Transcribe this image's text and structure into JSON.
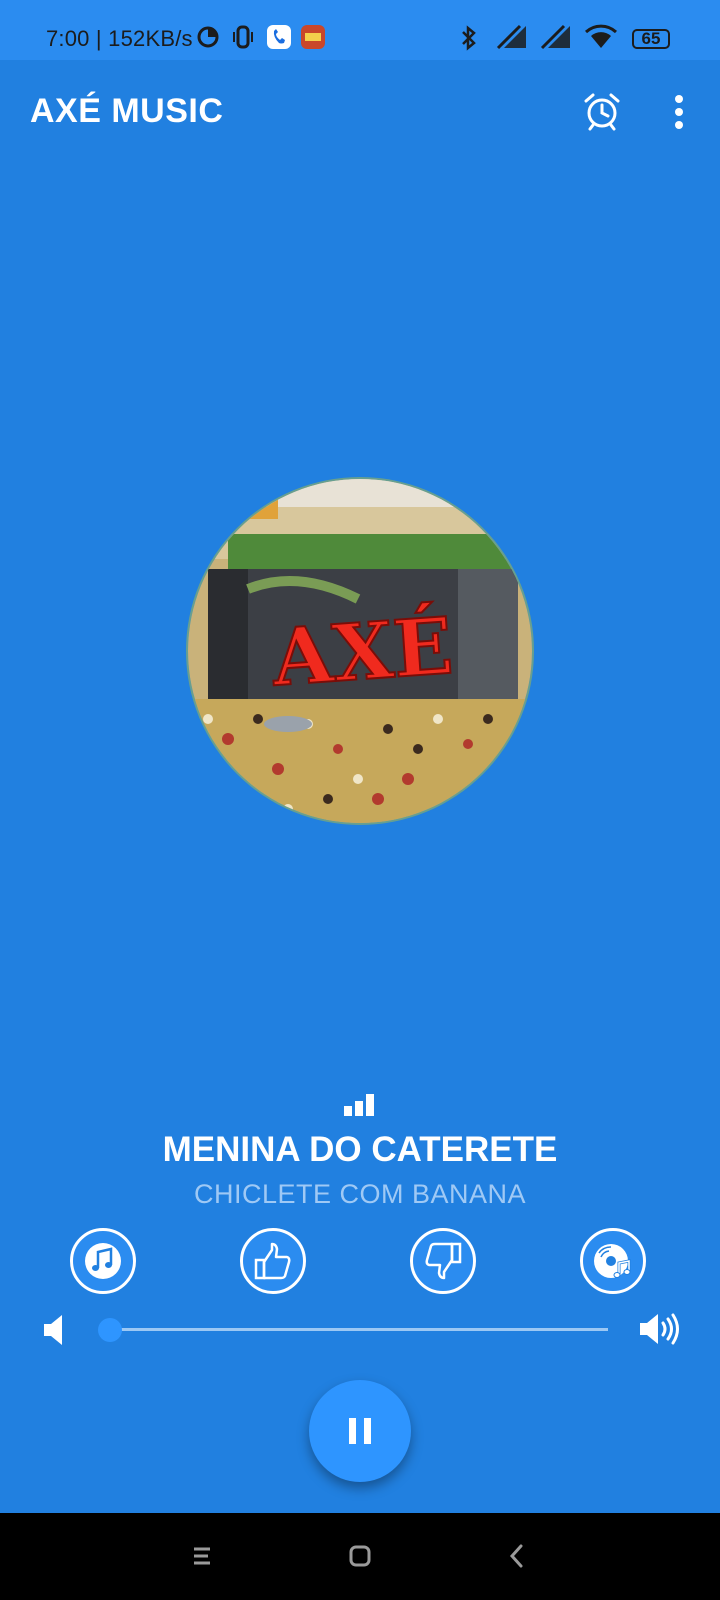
{
  "status_bar": {
    "time_speed": "7:00 | 152KB/s",
    "battery": "65"
  },
  "app_bar": {
    "title": "AXÉ MUSIC"
  },
  "album_art": {
    "logo_text": "AXÉ"
  },
  "track": {
    "title": "MENINA DO CATERETE",
    "artist": "CHICLETE COM BANANA"
  },
  "volume": {
    "level": 0.0
  },
  "colors": {
    "background": "#2180E0",
    "status_bar": "#2B8CF0",
    "accent": "#2E95FF",
    "artist_text": "#9FC9F5"
  },
  "icons": {
    "alarm": "alarm-icon",
    "menu": "more-vertical-icon",
    "equalizer": "equalizer-bars-icon",
    "music": "music-note-icon",
    "like": "thumbs-up-icon",
    "dislike": "thumbs-down-icon",
    "disc": "disc-music-icon",
    "volume_low": "volume-low-icon",
    "volume_high": "volume-high-icon",
    "pause": "pause-icon"
  }
}
